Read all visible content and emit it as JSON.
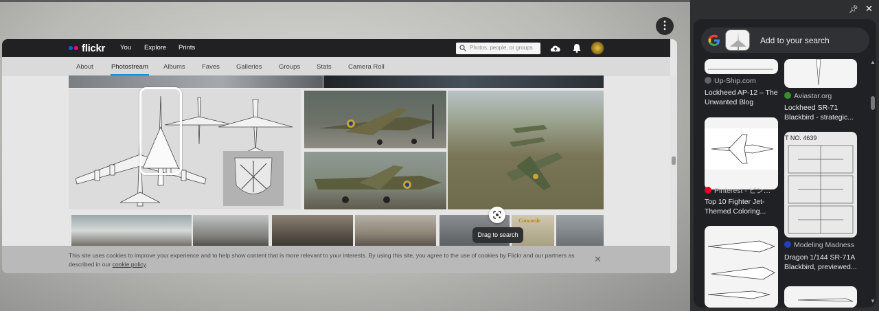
{
  "browser": {
    "menu_icon": "three-dots-vertical-icon"
  },
  "flickr": {
    "logo_text": "flickr",
    "nav": [
      "You",
      "Explore",
      "Prints"
    ],
    "search_placeholder": "Photos, people, or groups",
    "header_icons": [
      "upload-cloud-icon",
      "bell-icon",
      "avatar"
    ],
    "subnav": [
      "About",
      "Photostream",
      "Albums",
      "Faves",
      "Galleries",
      "Groups",
      "Stats",
      "Camera Roll"
    ],
    "subnav_active": "Photostream",
    "cookie_text": "This site uses cookies to improve your experience and to help show content that is more relevant to your interests. By using this site, you agree to the use of cookies by Flickr and our partners as described in our",
    "cookie_link": "cookie policy",
    "cookie_end": ".",
    "concorde_label": "Concorde"
  },
  "lens": {
    "drag_hint": "Drag to search"
  },
  "side_panel": {
    "search_placeholder": "Add to your search",
    "results": [
      {
        "source": "Up-Ship.com",
        "title": "Lockheed AP-12 – The Unwanted Blog"
      },
      {
        "source": "Aviastar.org",
        "title": "Lockheed SR-71 Blackbird - strategic..."
      },
      {
        "source": "Pinterest - ピン…",
        "title": "Top 10 Fighter Jet-Themed Coloring..."
      },
      {
        "source": "Modeling Madness",
        "title": "Dragon 1/144 SR-71A Blackbird, previewed..."
      }
    ],
    "card_text": "T NO. 4639"
  },
  "colors": {
    "flickr_blue": "#0063dc",
    "flickr_pink": "#ff0084",
    "active_tab": "#128fdc",
    "panel_bg": "#202124"
  }
}
